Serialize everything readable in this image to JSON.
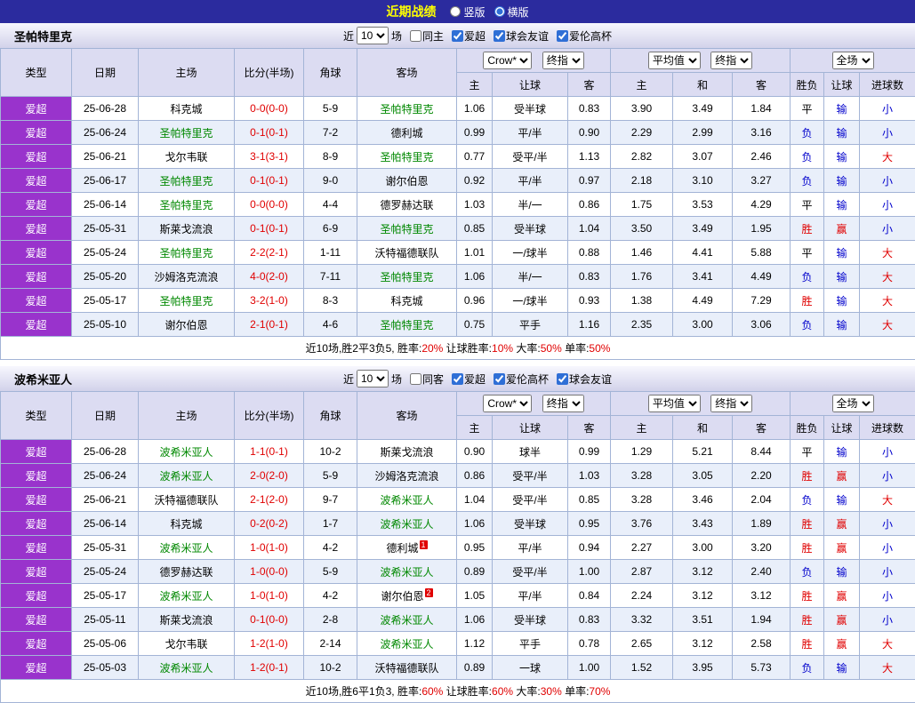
{
  "colors": {
    "topbar_bg": "#2b2b9e",
    "title_color": "#ffff00",
    "header_bg": "#dcdcf2",
    "border": "#a3b4d6",
    "alt_row": "#e9effa",
    "league_bg": "#9933cc",
    "green_team": "#008800",
    "red": "#e00000",
    "blue": "#0000cc"
  },
  "topbar": {
    "title": "近期战绩",
    "layout_options": [
      {
        "label": "竖版",
        "checked": false
      },
      {
        "label": "横版",
        "checked": true
      }
    ]
  },
  "table_header": {
    "type": "类型",
    "date": "日期",
    "home": "主场",
    "score": "比分(半场)",
    "corners": "角球",
    "away": "客场",
    "sel_company": "Crow*",
    "sel_final1": "终指",
    "h_home": "主",
    "h_handicap": "让球",
    "h_away": "客",
    "sel_avg": "平均值",
    "sel_final2": "终指",
    "a_home": "主",
    "a_draw": "和",
    "a_away": "客",
    "sel_fulltime": "全场",
    "r_result": "胜负",
    "r_handicap": "让球",
    "r_goals": "进球数"
  },
  "result_colors": {
    "胜": "red",
    "赢": "red",
    "大": "red",
    "负": "blue",
    "输": "blue",
    "小": "blue",
    "平": "dark"
  },
  "sections": [
    {
      "team": "圣帕特里克",
      "filter": {
        "near": "近",
        "count": "10",
        "games": "场",
        "same_label": "同主",
        "same_checked": false,
        "options": [
          {
            "label": "爱超",
            "checked": true
          },
          {
            "label": "球会友谊",
            "checked": true
          },
          {
            "label": "爱伦高杯",
            "checked": true
          }
        ]
      },
      "rows": [
        {
          "league": "爱超",
          "date": "25-06-28",
          "home": "科克城",
          "home_green": false,
          "score": "0-0(0-0)",
          "corners": "5-9",
          "away": "圣帕特里克",
          "away_green": true,
          "asian": [
            "1.06",
            "受半球",
            "0.83"
          ],
          "euro": [
            "3.90",
            "3.49",
            "1.84"
          ],
          "result": "平",
          "handicap_result": "输",
          "goals": "小"
        },
        {
          "league": "爱超",
          "date": "25-06-24",
          "home": "圣帕特里克",
          "home_green": true,
          "score": "0-1(0-1)",
          "corners": "7-2",
          "away": "德利城",
          "away_green": false,
          "asian": [
            "0.99",
            "平/半",
            "0.90"
          ],
          "euro": [
            "2.29",
            "2.99",
            "3.16"
          ],
          "result": "负",
          "handicap_result": "输",
          "goals": "小"
        },
        {
          "league": "爱超",
          "date": "25-06-21",
          "home": "戈尔韦联",
          "home_green": false,
          "score": "3-1(3-1)",
          "corners": "8-9",
          "away": "圣帕特里克",
          "away_green": true,
          "asian": [
            "0.77",
            "受平/半",
            "1.13"
          ],
          "euro": [
            "2.82",
            "3.07",
            "2.46"
          ],
          "result": "负",
          "handicap_result": "输",
          "goals": "大"
        },
        {
          "league": "爱超",
          "date": "25-06-17",
          "home": "圣帕特里克",
          "home_green": true,
          "score": "0-1(0-1)",
          "corners": "9-0",
          "away": "谢尔伯恩",
          "away_green": false,
          "asian": [
            "0.92",
            "平/半",
            "0.97"
          ],
          "euro": [
            "2.18",
            "3.10",
            "3.27"
          ],
          "result": "负",
          "handicap_result": "输",
          "goals": "小"
        },
        {
          "league": "爱超",
          "date": "25-06-14",
          "home": "圣帕特里克",
          "home_green": true,
          "score": "0-0(0-0)",
          "corners": "4-4",
          "away": "德罗赫达联",
          "away_green": false,
          "asian": [
            "1.03",
            "半/一",
            "0.86"
          ],
          "euro": [
            "1.75",
            "3.53",
            "4.29"
          ],
          "result": "平",
          "handicap_result": "输",
          "goals": "小"
        },
        {
          "league": "爱超",
          "date": "25-05-31",
          "home": "斯莱戈流浪",
          "home_green": false,
          "score": "0-1(0-1)",
          "corners": "6-9",
          "away": "圣帕特里克",
          "away_green": true,
          "asian": [
            "0.85",
            "受半球",
            "1.04"
          ],
          "euro": [
            "3.50",
            "3.49",
            "1.95"
          ],
          "result": "胜",
          "handicap_result": "赢",
          "goals": "小"
        },
        {
          "league": "爱超",
          "date": "25-05-24",
          "home": "圣帕特里克",
          "home_green": true,
          "score": "2-2(2-1)",
          "corners": "1-11",
          "away": "沃特福德联队",
          "away_green": false,
          "asian": [
            "1.01",
            "一/球半",
            "0.88"
          ],
          "euro": [
            "1.46",
            "4.41",
            "5.88"
          ],
          "result": "平",
          "handicap_result": "输",
          "goals": "大"
        },
        {
          "league": "爱超",
          "date": "25-05-20",
          "home": "沙姆洛克流浪",
          "home_green": false,
          "score": "4-0(2-0)",
          "corners": "7-11",
          "away": "圣帕特里克",
          "away_green": true,
          "asian": [
            "1.06",
            "半/一",
            "0.83"
          ],
          "euro": [
            "1.76",
            "3.41",
            "4.49"
          ],
          "result": "负",
          "handicap_result": "输",
          "goals": "大"
        },
        {
          "league": "爱超",
          "date": "25-05-17",
          "home": "圣帕特里克",
          "home_green": true,
          "score": "3-2(1-0)",
          "corners": "8-3",
          "away": "科克城",
          "away_green": false,
          "asian": [
            "0.96",
            "一/球半",
            "0.93"
          ],
          "euro": [
            "1.38",
            "4.49",
            "7.29"
          ],
          "result": "胜",
          "handicap_result": "输",
          "goals": "大"
        },
        {
          "league": "爱超",
          "date": "25-05-10",
          "home": "谢尔伯恩",
          "home_green": false,
          "score": "2-1(0-1)",
          "corners": "4-6",
          "away": "圣帕特里克",
          "away_green": true,
          "asian": [
            "0.75",
            "平手",
            "1.16"
          ],
          "euro": [
            "2.35",
            "3.00",
            "3.06"
          ],
          "result": "负",
          "handicap_result": "输",
          "goals": "大"
        }
      ],
      "summary_parts": [
        [
          "近10场,胜2平3负5, 胜率:",
          "k"
        ],
        [
          "20%",
          "r"
        ],
        [
          " 让球胜率:",
          "k"
        ],
        [
          "10%",
          "r"
        ],
        [
          " 大率:",
          "k"
        ],
        [
          "50%",
          "r"
        ],
        [
          " 单率:",
          "k"
        ],
        [
          "50%",
          "r"
        ]
      ]
    },
    {
      "team": "波希米亚人",
      "filter": {
        "near": "近",
        "count": "10",
        "games": "场",
        "same_label": "同客",
        "same_checked": false,
        "options": [
          {
            "label": "爱超",
            "checked": true
          },
          {
            "label": "爱伦高杯",
            "checked": true
          },
          {
            "label": "球会友谊",
            "checked": true
          }
        ]
      },
      "rows": [
        {
          "league": "爱超",
          "date": "25-06-28",
          "home": "波希米亚人",
          "home_green": true,
          "score": "1-1(0-1)",
          "corners": "10-2",
          "away": "斯莱戈流浪",
          "away_green": false,
          "asian": [
            "0.90",
            "球半",
            "0.99"
          ],
          "euro": [
            "1.29",
            "5.21",
            "8.44"
          ],
          "result": "平",
          "handicap_result": "输",
          "goals": "小"
        },
        {
          "league": "爱超",
          "date": "25-06-24",
          "home": "波希米亚人",
          "home_green": true,
          "score": "2-0(2-0)",
          "corners": "5-9",
          "away": "沙姆洛克流浪",
          "away_green": false,
          "asian": [
            "0.86",
            "受平/半",
            "1.03"
          ],
          "euro": [
            "3.28",
            "3.05",
            "2.20"
          ],
          "result": "胜",
          "handicap_result": "赢",
          "goals": "小"
        },
        {
          "league": "爱超",
          "date": "25-06-21",
          "home": "沃特福德联队",
          "home_green": false,
          "score": "2-1(2-0)",
          "corners": "9-7",
          "away": "波希米亚人",
          "away_green": true,
          "asian": [
            "1.04",
            "受平/半",
            "0.85"
          ],
          "euro": [
            "3.28",
            "3.46",
            "2.04"
          ],
          "result": "负",
          "handicap_result": "输",
          "goals": "大"
        },
        {
          "league": "爱超",
          "date": "25-06-14",
          "home": "科克城",
          "home_green": false,
          "score": "0-2(0-2)",
          "corners": "1-7",
          "away": "波希米亚人",
          "away_green": true,
          "asian": [
            "1.06",
            "受半球",
            "0.95"
          ],
          "euro": [
            "3.76",
            "3.43",
            "1.89"
          ],
          "result": "胜",
          "handicap_result": "赢",
          "goals": "小"
        },
        {
          "league": "爱超",
          "date": "25-05-31",
          "home": "波希米亚人",
          "home_green": true,
          "score": "1-0(1-0)",
          "corners": "4-2",
          "away": "德利城",
          "away_green": false,
          "away_rank": "1",
          "asian": [
            "0.95",
            "平/半",
            "0.94"
          ],
          "euro": [
            "2.27",
            "3.00",
            "3.20"
          ],
          "result": "胜",
          "handicap_result": "赢",
          "goals": "小"
        },
        {
          "league": "爱超",
          "date": "25-05-24",
          "home": "德罗赫达联",
          "home_green": false,
          "score": "1-0(0-0)",
          "corners": "5-9",
          "away": "波希米亚人",
          "away_green": true,
          "asian": [
            "0.89",
            "受平/半",
            "1.00"
          ],
          "euro": [
            "2.87",
            "3.12",
            "2.40"
          ],
          "result": "负",
          "handicap_result": "输",
          "goals": "小"
        },
        {
          "league": "爱超",
          "date": "25-05-17",
          "home": "波希米亚人",
          "home_green": true,
          "score": "1-0(1-0)",
          "corners": "4-2",
          "away": "谢尔伯恩",
          "away_green": false,
          "away_rank": "2",
          "asian": [
            "1.05",
            "平/半",
            "0.84"
          ],
          "euro": [
            "2.24",
            "3.12",
            "3.12"
          ],
          "result": "胜",
          "handicap_result": "赢",
          "goals": "小"
        },
        {
          "league": "爱超",
          "date": "25-05-11",
          "home": "斯莱戈流浪",
          "home_green": false,
          "score": "0-1(0-0)",
          "corners": "2-8",
          "away": "波希米亚人",
          "away_green": true,
          "asian": [
            "1.06",
            "受半球",
            "0.83"
          ],
          "euro": [
            "3.32",
            "3.51",
            "1.94"
          ],
          "result": "胜",
          "handicap_result": "赢",
          "goals": "小"
        },
        {
          "league": "爱超",
          "date": "25-05-06",
          "home": "戈尔韦联",
          "home_green": false,
          "score": "1-2(1-0)",
          "corners": "2-14",
          "away": "波希米亚人",
          "away_green": true,
          "asian": [
            "1.12",
            "平手",
            "0.78"
          ],
          "euro": [
            "2.65",
            "3.12",
            "2.58"
          ],
          "result": "胜",
          "handicap_result": "赢",
          "goals": "大"
        },
        {
          "league": "爱超",
          "date": "25-05-03",
          "home": "波希米亚人",
          "home_green": true,
          "score": "1-2(0-1)",
          "corners": "10-2",
          "away": "沃特福德联队",
          "away_green": false,
          "asian": [
            "0.89",
            "一球",
            "1.00"
          ],
          "euro": [
            "1.52",
            "3.95",
            "5.73"
          ],
          "result": "负",
          "handicap_result": "输",
          "goals": "大"
        }
      ],
      "summary_parts": [
        [
          "近10场,胜6平1负3, 胜率:",
          "k"
        ],
        [
          "60%",
          "r"
        ],
        [
          " 让球胜率:",
          "k"
        ],
        [
          "60%",
          "r"
        ],
        [
          " 大率:",
          "k"
        ],
        [
          "30%",
          "r"
        ],
        [
          " 单率:",
          "k"
        ],
        [
          "70%",
          "r"
        ]
      ]
    }
  ]
}
